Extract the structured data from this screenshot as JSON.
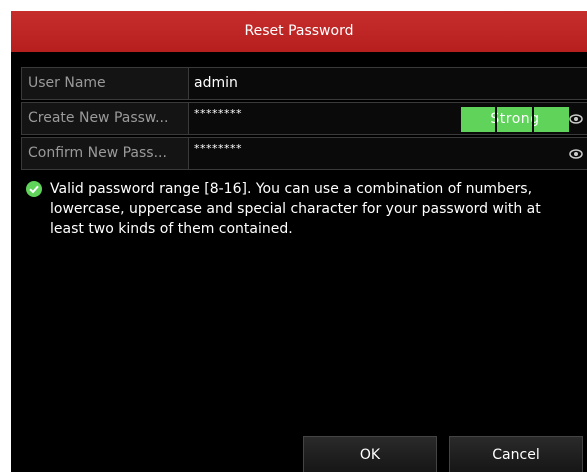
{
  "dialog": {
    "title": "Reset Password"
  },
  "form": {
    "username": {
      "label": "User Name",
      "value": "admin"
    },
    "new_password": {
      "label": "Create New Passw...",
      "value": "********",
      "strength_label": "Strong",
      "strength_color": "#5fd35a"
    },
    "confirm_password": {
      "label": "Confirm New Pass...",
      "value": "********"
    }
  },
  "hint": {
    "icon": "check-circle-icon",
    "text": "Valid password range [8-16]. You can use a combination of numbers, lowercase, uppercase and special character for your password with at least two kinds of them contained."
  },
  "buttons": {
    "ok_label": "OK",
    "cancel_label": "Cancel"
  },
  "colors": {
    "title_bar": "#c0272d",
    "dialog_bg": "#000000",
    "valid_check": "#5fd35a"
  }
}
